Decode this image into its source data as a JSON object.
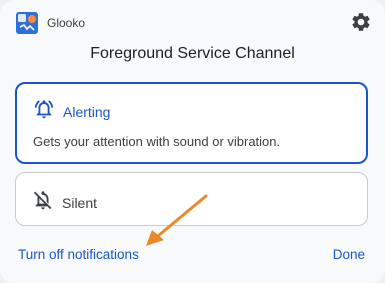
{
  "app": {
    "name": "Glooko",
    "icon": "glooko-app-icon",
    "settings_icon": "gear-icon"
  },
  "dialog": {
    "title": "Foreground Service Channel"
  },
  "options": [
    {
      "label": "Alerting",
      "description": "Gets your attention with sound or vibration.",
      "icon": "bell-icon",
      "selected": true
    },
    {
      "label": "Silent",
      "icon": "bell-off-icon",
      "selected": false
    }
  ],
  "footer": {
    "turn_off_label": "Turn off notifications",
    "done_label": "Done"
  },
  "colors": {
    "accent": "#1a56c9",
    "annotation_arrow": "#e8892a"
  }
}
